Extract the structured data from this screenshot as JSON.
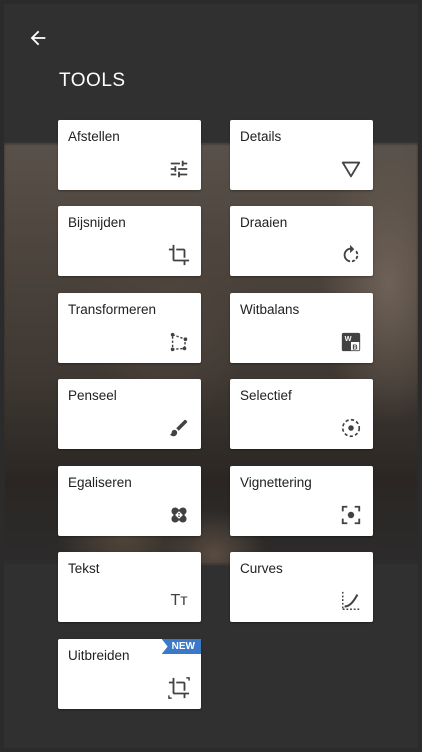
{
  "header": {
    "back_icon": "arrow-left-icon",
    "title": "TOOLS"
  },
  "tools": [
    {
      "label": "Afstellen",
      "icon": "tune-sliders-icon"
    },
    {
      "label": "Details",
      "icon": "triangle-down-icon"
    },
    {
      "label": "Bijsnijden",
      "icon": "crop-icon"
    },
    {
      "label": "Draaien",
      "icon": "rotate-icon"
    },
    {
      "label": "Transformeren",
      "icon": "perspective-icon"
    },
    {
      "label": "Witbalans",
      "icon": "white-balance-icon"
    },
    {
      "label": "Penseel",
      "icon": "brush-icon"
    },
    {
      "label": "Selectief",
      "icon": "selective-target-icon"
    },
    {
      "label": "Egaliseren",
      "icon": "healing-bandage-icon"
    },
    {
      "label": "Vignettering",
      "icon": "vignette-icon"
    },
    {
      "label": "Tekst",
      "icon": "text-icon",
      "glyph": "Tт"
    },
    {
      "label": "Curves",
      "icon": "curves-icon"
    },
    {
      "label": "Uitbreiden",
      "icon": "expand-icon",
      "badge": "NEW"
    }
  ],
  "colors": {
    "background": "#303030",
    "tile": "#ffffff",
    "badge": "#3b79c8"
  }
}
